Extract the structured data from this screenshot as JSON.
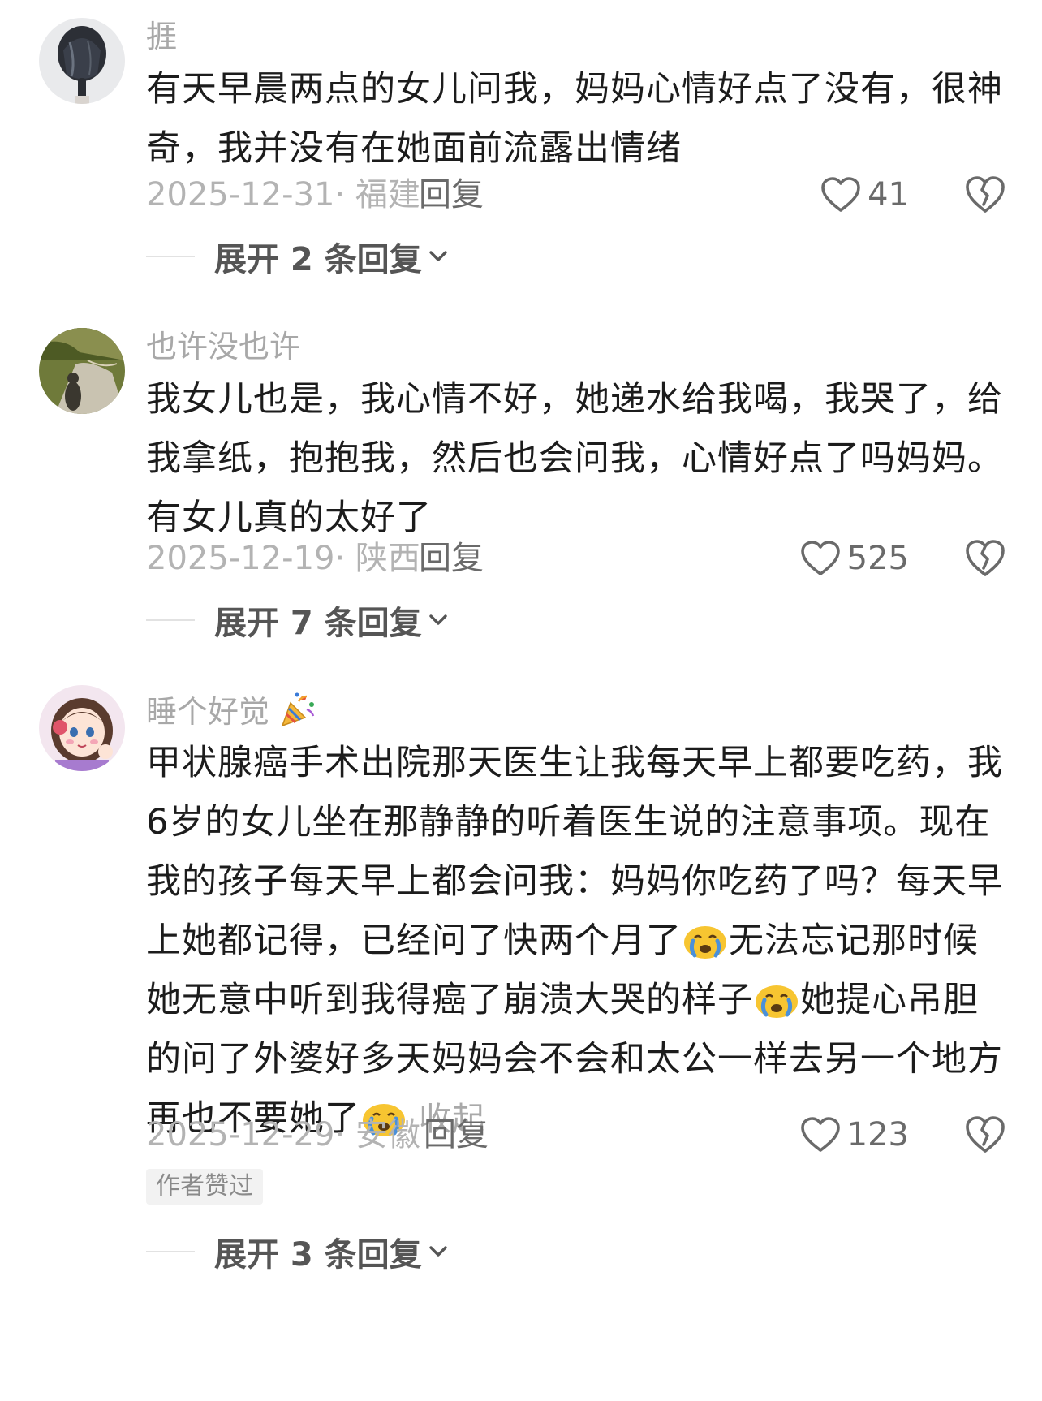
{
  "comments": [
    {
      "username": "捱",
      "text": "有天早晨两点的女儿问我，妈妈心情好点了没有，很神奇，我并没有在她面前流露出情绪",
      "date_location": "2025-12-31· 福建",
      "reply_label": "回复",
      "likes": "41",
      "expand_label": "展开 2 条回复",
      "avatar_icon": "hair-back-avatar"
    },
    {
      "username": "也许没也许",
      "text": "我女儿也是，我心情不好，她递水给我喝，我哭了，给我拿纸，抱抱我，然后也会问我，心情好点了吗妈妈。有女儿真的太好了",
      "date_location": "2025-12-19· 陕西",
      "reply_label": "回复",
      "likes": "525",
      "expand_label": "展开 7 条回复",
      "avatar_icon": "road-shadow-avatar"
    },
    {
      "username": "睡个好觉",
      "username_emoji": "party-popper-icon",
      "text_parts": [
        "甲状腺癌手术出院那天医生让我每天早上都要吃药，我6岁的女儿坐在那静静的听着医生说的注意事项。现在我的孩子每天早上都会问我：妈妈你吃药了吗？每天早上她都记得，已经问了快两个月了",
        "无法忘记那时候她无意中听到我得癌了崩溃大哭的样子",
        "她提心吊胆的问了外婆好多天妈妈会不会和太公一样去另一个地方再也不要她了"
      ],
      "collapse_label": "收起",
      "date_location": "2025-12-29· 安徽",
      "reply_label": "回复",
      "likes": "123",
      "author_badge": "作者赞过",
      "expand_label": "展开 3 条回复",
      "avatar_icon": "cartoon-girl-avatar"
    }
  ],
  "icons": {
    "like": "heart-outline-icon",
    "dislike": "broken-heart-icon",
    "expand": "chevron-down-icon",
    "crying": "crying-face-emoji"
  },
  "colors": {
    "username": "#a8a8a8",
    "body_text": "#1c1c1c",
    "meta": "#b3b3b3",
    "reply": "#6a6a6a",
    "emoji_yellow": "#f7c531",
    "tear_blue": "#4a90d9"
  }
}
